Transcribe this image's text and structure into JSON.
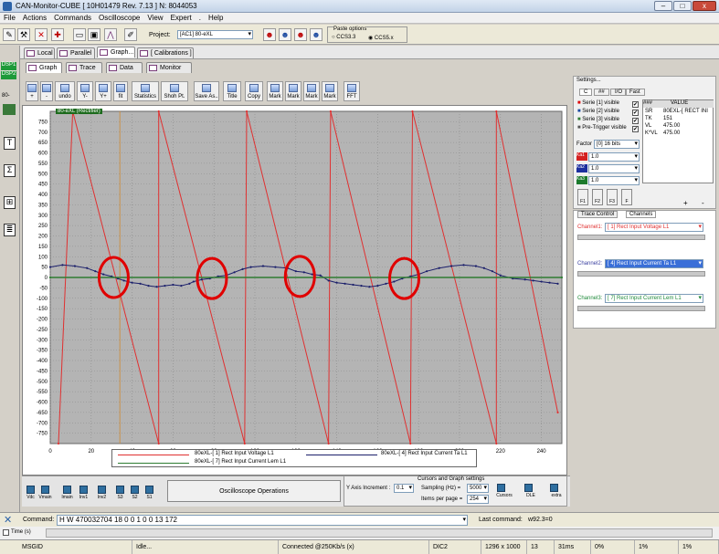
{
  "window": {
    "title": "CAN-Monitor-CUBE [ 10H01479 Rev. 7.13 ] N: 8044053",
    "close": "x",
    "minimize": "–",
    "maximize": "□"
  },
  "menu": [
    "File",
    "Actions",
    "Commands",
    "Oscilloscope",
    "View",
    "Expert",
    ".",
    "Help"
  ],
  "project": {
    "label": "Project:",
    "value": "[AC1] 80-eXL"
  },
  "paste_options": {
    "title": "Paste options",
    "option1": "CCS3.3",
    "option2": "CCS5.x"
  },
  "top_tabs": [
    "Local",
    "Parallel",
    "Graph...",
    "[ Calibrations ]"
  ],
  "left_labels": {
    "dsp1": "DSP1",
    "dsp2": "DSP2",
    "num": "80-"
  },
  "sub_tabs": [
    "Graph",
    "Trace",
    "Data",
    "Monitor"
  ],
  "graph_buttons": [
    "+",
    "-",
    "undo",
    "Y-",
    "Y+",
    "fit",
    "Statistics",
    "Shoh Pt.",
    "Save As..",
    "Title",
    "Copy",
    "Mark",
    "Mark",
    "Mark",
    "Mark",
    "FFT"
  ],
  "chart_data": {
    "type": "line",
    "title": "80-eXL (Rectifier)",
    "xlim": [
      0,
      250
    ],
    "ylim": [
      -800,
      800
    ],
    "xticks": [
      0,
      20,
      40,
      60,
      80,
      100,
      120,
      140,
      160,
      180,
      200,
      220,
      240
    ],
    "yticks": [
      750,
      700,
      650,
      600,
      550,
      500,
      450,
      400,
      350,
      300,
      250,
      200,
      150,
      100,
      50,
      0,
      -50,
      -100,
      -150,
      -200,
      -250,
      -300,
      -350,
      -400,
      -450,
      -500,
      -550,
      -600,
      -650,
      -700,
      -750
    ],
    "grid": true,
    "series": [
      {
        "name": "80eXL-[ 1] Rect Input Voltage L1",
        "color": "#e03030",
        "points": [
          [
            4,
            -800
          ],
          [
            11,
            800
          ],
          [
            11,
            800
          ],
          [
            53,
            -800
          ],
          [
            53,
            800
          ],
          [
            95,
            -800
          ],
          [
            96,
            800
          ],
          [
            136,
            -800
          ],
          [
            137,
            800
          ],
          [
            176,
            -800
          ],
          [
            177,
            800
          ],
          [
            218,
            -800
          ],
          [
            218,
            800
          ],
          [
            248,
            -650
          ]
        ]
      },
      {
        "name": "80eXL-[ 4] Rect Input Current Ta L1",
        "color": "#1b1f6b",
        "points": [
          [
            0,
            50
          ],
          [
            6,
            60
          ],
          [
            12,
            55
          ],
          [
            18,
            45
          ],
          [
            22,
            30
          ],
          [
            26,
            15
          ],
          [
            30,
            5
          ],
          [
            33,
            -5
          ],
          [
            36,
            -15
          ],
          [
            40,
            -25
          ],
          [
            44,
            -30
          ],
          [
            48,
            -40
          ],
          [
            52,
            -45
          ],
          [
            56,
            -40
          ],
          [
            60,
            -35
          ],
          [
            64,
            -40
          ],
          [
            68,
            -30
          ],
          [
            70,
            -20
          ],
          [
            74,
            -10
          ],
          [
            78,
            -5
          ],
          [
            82,
            5
          ],
          [
            86,
            10
          ],
          [
            90,
            25
          ],
          [
            94,
            40
          ],
          [
            98,
            50
          ],
          [
            104,
            55
          ],
          [
            110,
            50
          ],
          [
            116,
            45
          ],
          [
            120,
            30
          ],
          [
            124,
            25
          ],
          [
            128,
            15
          ],
          [
            132,
            10
          ],
          [
            136,
            -15
          ],
          [
            140,
            -25
          ],
          [
            144,
            -30
          ],
          [
            148,
            -35
          ],
          [
            152,
            -40
          ],
          [
            156,
            -45
          ],
          [
            160,
            -40
          ],
          [
            164,
            -30
          ],
          [
            168,
            -20
          ],
          [
            172,
            -5
          ],
          [
            176,
            5
          ],
          [
            180,
            15
          ],
          [
            184,
            30
          ],
          [
            190,
            45
          ],
          [
            196,
            55
          ],
          [
            202,
            60
          ],
          [
            208,
            55
          ],
          [
            212,
            45
          ],
          [
            216,
            30
          ],
          [
            220,
            10
          ],
          [
            226,
            -5
          ],
          [
            232,
            -10
          ],
          [
            236,
            -15
          ],
          [
            240,
            -20
          ],
          [
            244,
            -25
          ],
          [
            248,
            -30
          ]
        ]
      },
      {
        "name": "80eXL-[ 7] Rect Input Current Lem L1",
        "color": "#2e7d32",
        "points": [
          [
            0,
            0
          ],
          [
            250,
            0
          ]
        ]
      }
    ],
    "annotations": [
      {
        "type": "ellipse",
        "x": 31,
        "y": 0
      },
      {
        "type": "ellipse",
        "x": 79,
        "y": -5
      },
      {
        "type": "ellipse",
        "x": 122,
        "y": 5
      },
      {
        "type": "ellipse",
        "x": 173,
        "y": -5
      }
    ]
  },
  "settings": {
    "title": "Settings...",
    "tabs": [
      "C",
      "##",
      "I/O",
      "Fast"
    ],
    "series": [
      {
        "label": "Serie [1] visible",
        "checked": true
      },
      {
        "label": "Serie [2] visible",
        "checked": true
      },
      {
        "label": "Serie [3] visible",
        "checked": true
      },
      {
        "label": "Pre-Trigger visible",
        "checked": true
      }
    ],
    "factor_label": "Factor",
    "factor_value": "[0] 16 bits",
    "kv_header": [
      "###",
      "VALUE"
    ],
    "kv": [
      [
        "SR",
        "80EXL-[ RECT INI"
      ],
      [
        "TK",
        "151"
      ],
      [
        "VL",
        "475.00"
      ],
      [
        "K*VL",
        "475.00"
      ]
    ],
    "channels_small": [
      {
        "name": "Ka1",
        "value": "1.0",
        "color": "#d42020"
      },
      {
        "name": "Ka2",
        "value": "1.0",
        "color": "#1c2f9e"
      },
      {
        "name": "Ka3",
        "value": "1.0",
        "color": "#1c7a2c"
      }
    ],
    "fbuttons": [
      "F1",
      "F2",
      "F3",
      "F"
    ],
    "pm": [
      "+",
      "-"
    ]
  },
  "trace_tabs": [
    "Trace Control",
    "Channels"
  ],
  "channels": [
    {
      "label": "Channel1:",
      "value": "[ 1] Rect Input Voltage L1",
      "color": "#e03030"
    },
    {
      "label": "Channel2:",
      "value": "[ 4] Rect Input Current Ta L1",
      "color": "#3a3fa0"
    },
    {
      "label": "Channel3:",
      "value": "[ 7] Rect Input Current Lem L1",
      "color": "#1f8a3a"
    }
  ],
  "bottom_buttons": [
    "Vdc",
    "Vmain",
    "Imain",
    "Inv1",
    "Inv2",
    "S3",
    "S2",
    "S1"
  ],
  "osc_ops": "Oscilloscope Operations",
  "cursors": {
    "title": "Cursors and Graph settings",
    "yaxis_label": "Y Axis Increment :",
    "yaxis_value": "0.1",
    "sampling_label": "Sampling (Hz) =",
    "sampling_value": "5000",
    "items_label": "Items per page =",
    "items_value": "254",
    "buttons": [
      "Graph",
      "Cursors",
      "DLE",
      "extra"
    ]
  },
  "command": {
    "label": "Command:",
    "value": "H W 470032704 18 0 0 1 0 0 13 172",
    "last_label": "Last command:",
    "last_value": "w92.3=0"
  },
  "time_label": "Time (s)",
  "status": [
    "MSGID",
    "Idle...",
    "Connected @250Kb/s (x)",
    "DIC2",
    "1296 x 1000",
    "13",
    "31ms",
    "0%",
    "1%",
    "1%"
  ]
}
